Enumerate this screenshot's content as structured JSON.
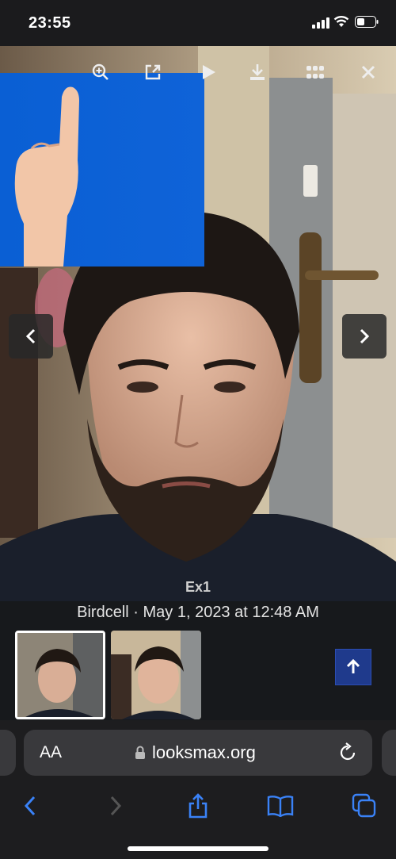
{
  "status_bar": {
    "time": "23:55"
  },
  "viewer": {
    "counter_text": "",
    "caption": "Ex1",
    "byline": "Birdcell · May 1, 2023 at 12:48 AM",
    "toolbar_icons": [
      "zoom-in-icon",
      "share-external-icon",
      "play-icon",
      "download-icon",
      "grid-icon",
      "close-icon"
    ]
  },
  "thumbnails": [
    {
      "name": "thumbnail-1",
      "selected": true
    },
    {
      "name": "thumbnail-2",
      "selected": false
    }
  ],
  "safari": {
    "aa_label": "AA",
    "url": "looksmax.org"
  },
  "colors": {
    "accent_blue": "#1f3a8c",
    "hand_background": "#0b5ed7",
    "safari_blue": "#3a82f7"
  }
}
